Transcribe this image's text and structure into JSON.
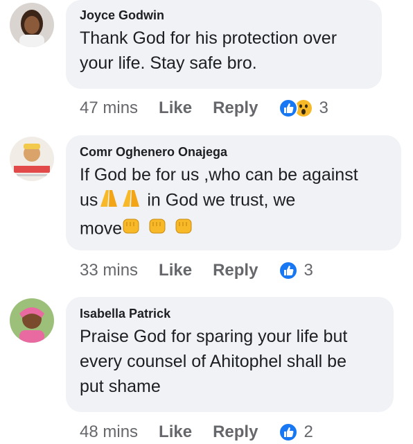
{
  "comments": [
    {
      "author": "Joyce Godwin",
      "text_lines": [
        "Thank God for his protection over",
        "your life. Stay safe bro."
      ],
      "time": "47 mins",
      "like_label": "Like",
      "reply_label": "Reply",
      "reactions": [
        "like-icon",
        "wow-icon"
      ],
      "reaction_count": "3"
    },
    {
      "author": "Comr Oghenero Onajega",
      "text_line1": "If God be for us ,who can be against",
      "text_line2_start": "us",
      "text_line2_end": "in God we trust, we",
      "text_line3": "move",
      "time": "33 mins",
      "like_label": "Like",
      "reply_label": "Reply",
      "reactions": [
        "like-icon"
      ],
      "reaction_count": "3"
    },
    {
      "author": "Isabella Patrick",
      "text_lines": [
        "Praise God for sparing your life but",
        "every counsel of Ahitophel shall be",
        "put shame"
      ],
      "time": "48 mins",
      "like_label": "Like",
      "reply_label": "Reply",
      "reactions": [
        "like-icon"
      ],
      "reaction_count": "2"
    }
  ],
  "colors": {
    "bubble": "#f0f2f5",
    "meta_text": "#65676b",
    "like_blue": "#1877f2",
    "wow_yellow": "#f7b928"
  }
}
